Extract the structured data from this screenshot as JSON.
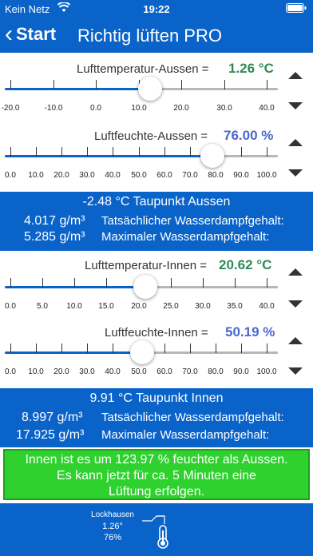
{
  "status_bar": {
    "carrier": "Kein Netz",
    "time": "19:22"
  },
  "nav": {
    "back_label": "Start",
    "title": "Richtig lüften PRO"
  },
  "aussen": {
    "temp": {
      "label": "Lufttemperatur-Aussen =",
      "value": "1.26 °C",
      "fraction": 0.5315,
      "ticks": [
        "-20.0",
        "-10.0",
        "0.0",
        "10.0",
        "20.0",
        "30.0",
        "40.0"
      ]
    },
    "humidity": {
      "label": "Luftfeuchte-Aussen =",
      "value": "76.00 %",
      "fraction": 0.76,
      "ticks": [
        "0.0",
        "10.0",
        "20.0",
        "30.0",
        "40.0",
        "50.0",
        "60.0",
        "70.0",
        "80.0",
        "90.0",
        "100.0"
      ]
    },
    "dewpoint": "-2.48 °C Taupunkt Aussen",
    "actual_value": "4.017 g/m³",
    "actual_label": "Tatsächlicher Wasserdampfgehalt:",
    "max_value": "5.285 g/m³",
    "max_label": "Maximaler Wasserdampfgehalt:"
  },
  "innen": {
    "temp": {
      "label": "Lufttemperatur-Innen =",
      "value": "20.62 °C",
      "fraction": 0.5155,
      "ticks": [
        "0.0",
        "5.0",
        "10.0",
        "15.0",
        "20.0",
        "25.0",
        "30.0",
        "35.0",
        "40.0"
      ]
    },
    "humidity": {
      "label": "Luftfeuchte-Innen =",
      "value": "50.19 %",
      "fraction": 0.5019,
      "ticks": [
        "0.0",
        "10.0",
        "20.0",
        "30.0",
        "40.0",
        "50.0",
        "60.0",
        "70.0",
        "80.0",
        "90.0",
        "100.0"
      ]
    },
    "dewpoint": "9.91 °C Taupunkt Innen",
    "actual_value": "8.997 g/m³",
    "actual_label": "Tatsächlicher Wasserdampfgehalt:",
    "max_value": "17.925 g/m³",
    "max_label": "Maximaler Wasserdampfgehalt:"
  },
  "result": {
    "line1": "Innen ist es um 123.97 % feuchter als Aussen.",
    "line2": "Es kann jetzt für ca. 5 Minuten eine",
    "line3": "Lüftung erfolgen."
  },
  "footer": {
    "location": "Lockhausen",
    "temp": "1.26°",
    "humidity": "76%"
  },
  "colors": {
    "brand_blue": "#0a63c9",
    "value_green": "#2e8b57",
    "value_blue": "#4a68d1",
    "result_green": "#2fd12f"
  }
}
